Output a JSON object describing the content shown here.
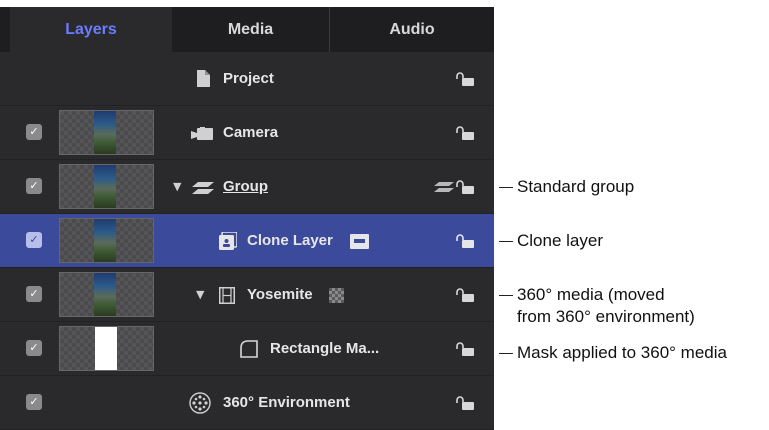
{
  "tabs": [
    {
      "label": "Layers",
      "active": true
    },
    {
      "label": "Media",
      "active": false
    },
    {
      "label": "Audio",
      "active": false
    }
  ],
  "rows": [
    {
      "name": "Project",
      "icon": "document-icon",
      "checked": null
    },
    {
      "name": "Camera",
      "icon": "camera-icon",
      "checked": true
    },
    {
      "name": "Group",
      "icon": "group-icon",
      "checked": true,
      "expanded": true
    },
    {
      "name": "Clone Layer",
      "icon": "clone-layer-icon",
      "checked": true,
      "selected": true
    },
    {
      "name": "Yosemite",
      "icon": "film-strip-icon",
      "checked": true,
      "expanded": true
    },
    {
      "name": "Rectangle Ma...",
      "icon": "mask-icon",
      "checked": true
    },
    {
      "name": "360° Environment",
      "icon": "360-environment-icon",
      "checked": true
    }
  ],
  "callouts": {
    "standard_group": "Standard group",
    "clone_layer": "Clone layer",
    "media_360_line1": "360° media (moved",
    "media_360_line2": "from 360° environment)",
    "mask": "Mask applied to 360° media"
  },
  "colors": {
    "panel_bg": "#2a2a2c",
    "tab_active": "#6b7bff",
    "selected_row": "#3c4a9c"
  },
  "checkmark": "✓"
}
